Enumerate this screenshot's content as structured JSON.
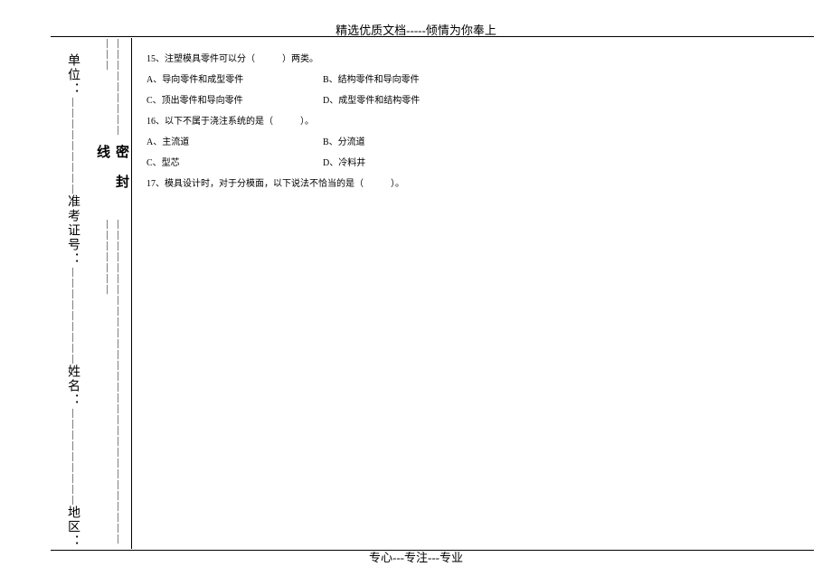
{
  "header": "精选优质文档-----倾情为你奉上",
  "footer": "专心---专注---专业",
  "sidebar": {
    "fields": {
      "region": "地区：",
      "name": "姓名：",
      "exam_id": "准考证号：",
      "unit": "单位："
    },
    "seal_label": "密封线"
  },
  "questions": {
    "q15": {
      "stem": "15、注塑模具零件可以分（　　　）两类。",
      "optA": "A、导向零件和成型零件",
      "optB": "B、结构零件和导向零件",
      "optC": "C、顶出零件和导向零件",
      "optD": "D、成型零件和结构零件"
    },
    "q16": {
      "stem": "16、以下不属于浇注系统的是（　　　）。",
      "optA": "A、主流道",
      "optB": "B、分流道",
      "optC": "C、型芯",
      "optD": "D、冷料井"
    },
    "q17": {
      "stem": "17、模具设计时，对于分模面，以下说法不恰当的是（　　　）。"
    }
  }
}
